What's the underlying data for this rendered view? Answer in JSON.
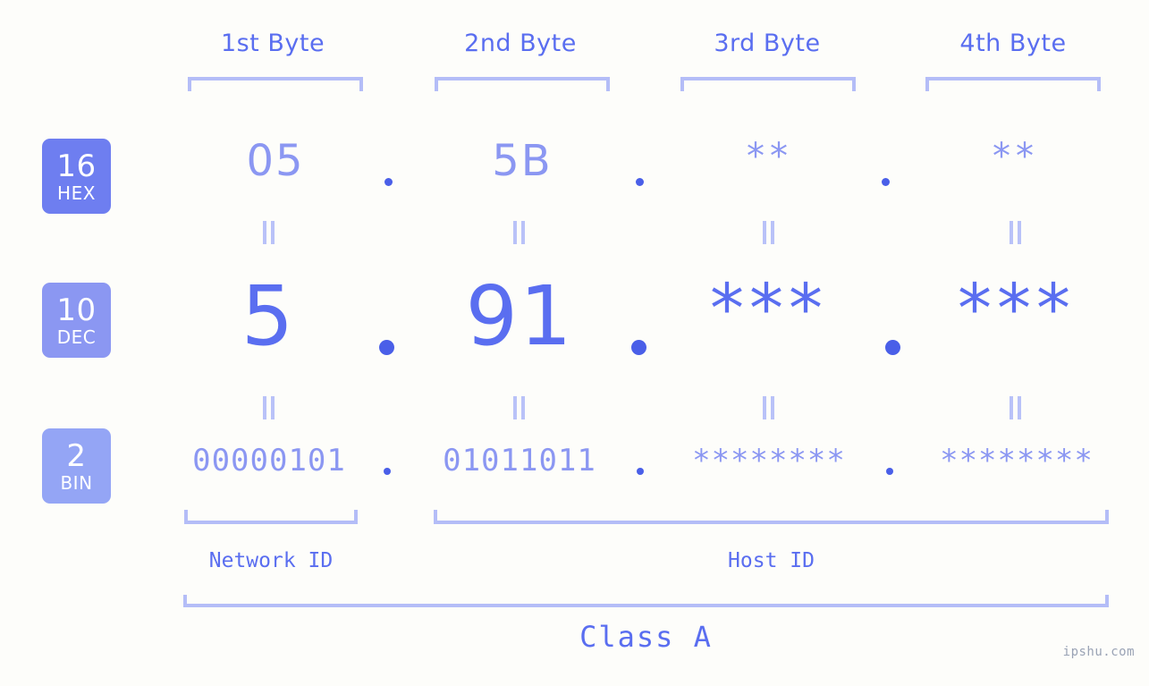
{
  "meta": {
    "watermark": "ipshu.com",
    "accent": "#5a6ef0",
    "accent_light": "#8b97f2",
    "bracket_color": "#b4bdf7",
    "background": "#fdfdfa"
  },
  "byte_headers": [
    {
      "label": "1st Byte"
    },
    {
      "label": "2nd Byte"
    },
    {
      "label": "3rd Byte"
    },
    {
      "label": "4th Byte"
    }
  ],
  "radix_rows": [
    {
      "id": "hex",
      "number": "16",
      "unit": "HEX",
      "color": "#6e7ef0"
    },
    {
      "id": "dec",
      "number": "10",
      "unit": "DEC",
      "color": "#8b97f2"
    },
    {
      "id": "bin",
      "number": "2",
      "unit": "BIN",
      "color": "#94a5f5"
    }
  ],
  "rows": {
    "hex": {
      "values": [
        "05",
        "5B",
        "**",
        "**"
      ],
      "separators": [
        ".",
        ".",
        "."
      ]
    },
    "dec": {
      "values": [
        "5",
        "91",
        "***",
        "***"
      ],
      "separators": [
        ".",
        ".",
        "."
      ]
    },
    "bin": {
      "values": [
        "00000101",
        "01011011",
        "********",
        "********"
      ],
      "separators": [
        ".",
        ".",
        "."
      ]
    }
  },
  "equals_markers": {
    "glyph": "=",
    "count_per_row": 4
  },
  "id_sections": [
    {
      "label": "Network ID"
    },
    {
      "label": "Host ID"
    }
  ],
  "class": {
    "label": "Class A"
  }
}
